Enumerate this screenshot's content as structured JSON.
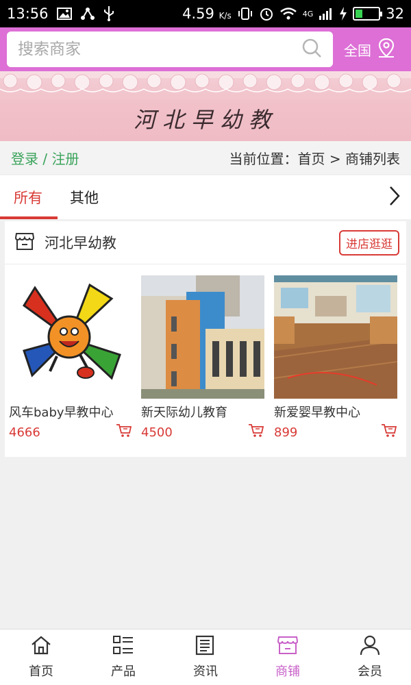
{
  "status_bar": {
    "time": "13:56",
    "speed": "4.59",
    "speed_unit": "K/s",
    "network": "4G",
    "battery_level": "32",
    "battery_fraction": 0.32
  },
  "search": {
    "placeholder": "搜索商家",
    "region_label": "全国",
    "icon": "search-icon"
  },
  "banner": {
    "title": "河北早幼教"
  },
  "crumbs": {
    "login": "登录 / 注册",
    "position": "当前位置：首页 > 商铺列表"
  },
  "tabs": [
    {
      "label": "所有",
      "active": true
    },
    {
      "label": "其他",
      "active": false
    }
  ],
  "shop": {
    "name": "河北早幼教",
    "visit_label": "进店逛逛",
    "products": [
      {
        "name": "风车baby早教中心",
        "price": "4666"
      },
      {
        "name": "新天际幼儿教育",
        "price": "4500"
      },
      {
        "name": "新爱婴早教中心",
        "price": "899"
      }
    ]
  },
  "bottom_nav": [
    {
      "label": "首页",
      "icon": "home-icon",
      "active": false
    },
    {
      "label": "产品",
      "icon": "grid-list-icon",
      "active": false
    },
    {
      "label": "资讯",
      "icon": "news-icon",
      "active": false
    },
    {
      "label": "商铺",
      "icon": "store-icon",
      "active": true
    },
    {
      "label": "会员",
      "icon": "user-icon",
      "active": false
    }
  ],
  "colors": {
    "header_bg": "#dd6fd6",
    "accent_red": "#d83a36",
    "login_green": "#3aa35b",
    "nav_active": "#c860c8"
  }
}
